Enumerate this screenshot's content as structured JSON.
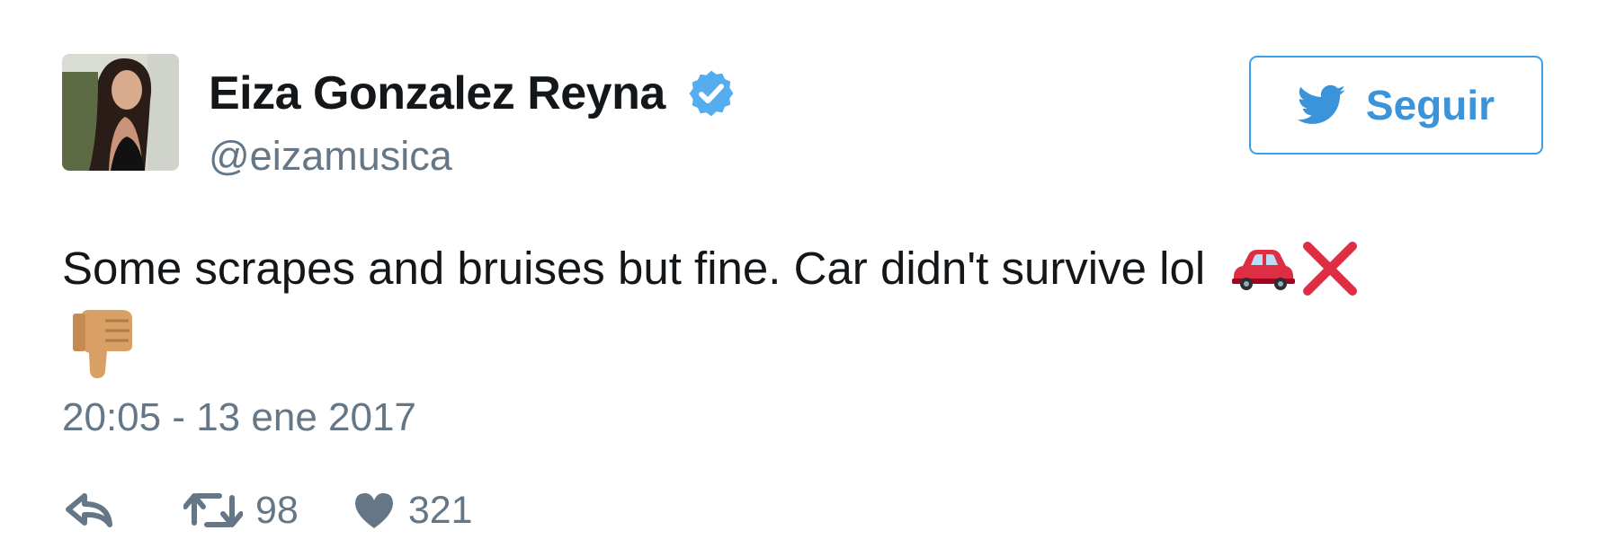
{
  "author": {
    "display_name": "Eiza Gonzalez Reyna",
    "handle": "@eizamusica",
    "verified_icon": "verified-badge-icon",
    "avatar": "profile-photo"
  },
  "follow_button": {
    "label": "Seguir",
    "icon": "twitter-bird-icon"
  },
  "tweet": {
    "text": "Some scrapes and bruises but fine. Car didn't survive lol",
    "emojis": [
      "car-emoji",
      "cross-mark-emoji",
      "thumbs-down-emoji"
    ],
    "timestamp": "20:05 - 13 ene 2017"
  },
  "actions": {
    "reply_icon": "reply-icon",
    "retweet_icon": "retweet-icon",
    "retweet_count": "98",
    "like_icon": "heart-icon",
    "like_count": "321"
  },
  "colors": {
    "accent": "#3b94d9",
    "verified": "#55acee",
    "muted": "#657786",
    "text": "#14171a",
    "cross": "#dd2e44"
  }
}
